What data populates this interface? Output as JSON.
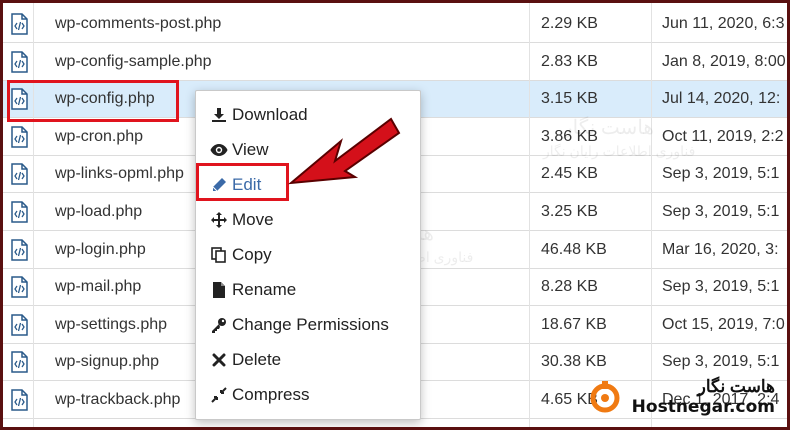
{
  "files": [
    {
      "name": "wp-comments-post.php",
      "size": "2.29 KB",
      "date": "Jun 11, 2020, 6:3"
    },
    {
      "name": "wp-config-sample.php",
      "size": "2.83 KB",
      "date": "Jan 8, 2019, 8:00"
    },
    {
      "name": "wp-config.php",
      "size": "3.15 KB",
      "date": "Jul 14, 2020, 12:"
    },
    {
      "name": "wp-cron.php",
      "size": "3.86 KB",
      "date": "Oct 11, 2019, 2:2"
    },
    {
      "name": "wp-links-opml.php",
      "size": "2.45 KB",
      "date": "Sep 3, 2019, 5:1"
    },
    {
      "name": "wp-load.php",
      "size": "3.25 KB",
      "date": "Sep 3, 2019, 5:1"
    },
    {
      "name": "wp-login.php",
      "size": "46.48 KB",
      "date": "Mar 16, 2020, 3:"
    },
    {
      "name": "wp-mail.php",
      "size": "8.28 KB",
      "date": "Sep 3, 2019, 5:1"
    },
    {
      "name": "wp-settings.php",
      "size": "18.67 KB",
      "date": "Oct 15, 2019, 7:0"
    },
    {
      "name": "wp-signup.php",
      "size": "30.38 KB",
      "date": "Sep 3, 2019, 5:1"
    },
    {
      "name": "wp-trackback.php",
      "size": "4.65 KB",
      "date": "Dec 1, 2017, 2:4"
    }
  ],
  "context_menu": {
    "download": "Download",
    "view": "View",
    "edit": "Edit",
    "move": "Move",
    "copy": "Copy",
    "rename": "Rename",
    "change_permissions": "Change Permissions",
    "delete": "Delete",
    "compress": "Compress"
  },
  "watermark": {
    "fa_title": "هاست نگار",
    "fa_subtitle": "فناوری اطلاعات رایان نگار"
  },
  "logo": {
    "fa": "هاست نگار",
    "en": "Hostnegar.com"
  },
  "colors": {
    "highlight": "#e0141e",
    "selected_row": "#d9ecfb",
    "arrow": "#d4101a",
    "brand_orange": "#f07a12"
  }
}
